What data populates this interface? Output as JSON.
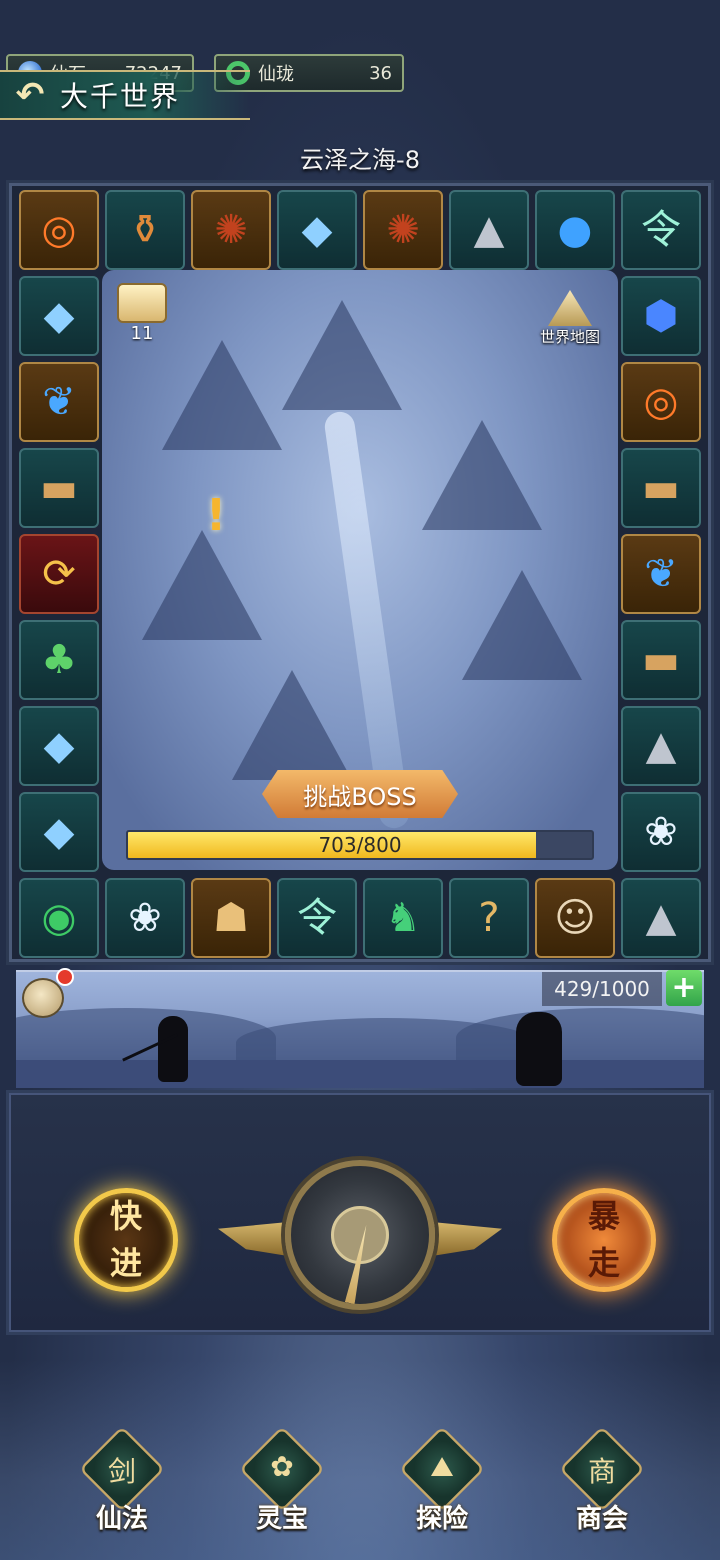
{
  "currency": {
    "stone": {
      "label": "仙石",
      "value": "72247"
    },
    "long": {
      "label": "仙珑",
      "value": "36"
    }
  },
  "header": {
    "back_glyph": "↶",
    "title": "大千世界"
  },
  "stage": {
    "title": "云泽之海-8"
  },
  "map": {
    "scroll_count": "11",
    "world_map_label": "世界地图",
    "alert_glyph": "!"
  },
  "boss": {
    "label": "挑战BOSS"
  },
  "progress": {
    "text": "703/800",
    "current": 703,
    "max": 800
  },
  "battle": {
    "energy_text": "429/1000",
    "plus_glyph": "+"
  },
  "controls": {
    "fast_line1": "快",
    "fast_line2": "进",
    "rage_line1": "暴",
    "rage_line2": "走"
  },
  "nav": [
    {
      "label": "仙法",
      "glyph": "剑"
    },
    {
      "label": "灵宝",
      "glyph": "✿"
    },
    {
      "label": "探险",
      "glyph": "⛰"
    },
    {
      "label": "商会",
      "glyph": "商"
    }
  ],
  "tiles": [
    {
      "icon": "fire-ring",
      "style": "gold",
      "glyph": "◎",
      "color": "#ff7a2a"
    },
    {
      "icon": "cauldron",
      "style": "teal",
      "glyph": "⚱",
      "color": "#e08a3a"
    },
    {
      "icon": "centipede",
      "style": "gold",
      "glyph": "✺",
      "color": "#c2421e"
    },
    {
      "icon": "blue-crystal",
      "style": "teal",
      "glyph": "◆",
      "color": "#8fd0ff"
    },
    {
      "icon": "centipede",
      "style": "gold",
      "glyph": "✺",
      "color": "#c2421e"
    },
    {
      "icon": "ore-rocks",
      "style": "teal",
      "glyph": "▲",
      "color": "#bfc5cf"
    },
    {
      "icon": "blue-orb",
      "style": "teal",
      "glyph": "●",
      "color": "#3fa2ff"
    },
    {
      "icon": "jade-token",
      "style": "teal",
      "glyph": "令",
      "color": "#9ff2d8"
    },
    {
      "icon": "blue-crystal",
      "style": "teal",
      "glyph": "◆",
      "color": "#8fd0ff"
    },
    {
      "icon": "blue-gem",
      "style": "teal",
      "glyph": "⬢",
      "color": "#4a86ff"
    },
    {
      "icon": "blue-butterfly",
      "style": "gold",
      "glyph": "❦",
      "color": "#4aa8ff"
    },
    {
      "icon": "fire-ring",
      "style": "gold",
      "glyph": "◎",
      "color": "#ff7a2a"
    },
    {
      "icon": "wood-log",
      "style": "teal",
      "glyph": "▬",
      "color": "#d7a360"
    },
    {
      "icon": "wood-log",
      "style": "teal",
      "glyph": "▬",
      "color": "#d7a360"
    },
    {
      "icon": "refresh-seal",
      "style": "red",
      "glyph": "⟳",
      "color": "#f5c14a"
    },
    {
      "icon": "blue-butterfly",
      "style": "gold",
      "glyph": "❦",
      "color": "#4aa8ff"
    },
    {
      "icon": "green-gourd",
      "style": "teal",
      "glyph": "♣",
      "color": "#5ed26a"
    },
    {
      "icon": "wood-log",
      "style": "teal",
      "glyph": "▬",
      "color": "#d7a360"
    },
    {
      "icon": "blue-crystal",
      "style": "teal",
      "glyph": "◆",
      "color": "#8fd0ff"
    },
    {
      "icon": "ore-rocks",
      "style": "teal",
      "glyph": "▲",
      "color": "#bfc5cf"
    },
    {
      "icon": "blue-crystal",
      "style": "teal",
      "glyph": "◆",
      "color": "#8fd0ff"
    },
    {
      "icon": "spirit-flower",
      "style": "teal",
      "glyph": "❀",
      "color": "#e7f4ff"
    },
    {
      "icon": "jade-ring",
      "style": "teal",
      "glyph": "◉",
      "color": "#3ecb66"
    },
    {
      "icon": "spirit-flower",
      "style": "teal",
      "glyph": "❀",
      "color": "#e7f4ff"
    },
    {
      "icon": "tiger-mask",
      "style": "gold",
      "glyph": "☗",
      "color": "#e9c07a"
    },
    {
      "icon": "jade-token",
      "style": "teal",
      "glyph": "令",
      "color": "#9ff2d8"
    },
    {
      "icon": "jade-dragon",
      "style": "teal",
      "glyph": "♞",
      "color": "#45d07a"
    },
    {
      "icon": "mystery-scroll",
      "style": "teal",
      "glyph": "?",
      "color": "#e4b866"
    },
    {
      "icon": "warrior-portrait",
      "style": "gold",
      "glyph": "☺",
      "color": "#e9d7b8"
    },
    {
      "icon": "ore-rocks",
      "style": "teal",
      "glyph": "▲",
      "color": "#bfc5cf"
    }
  ]
}
